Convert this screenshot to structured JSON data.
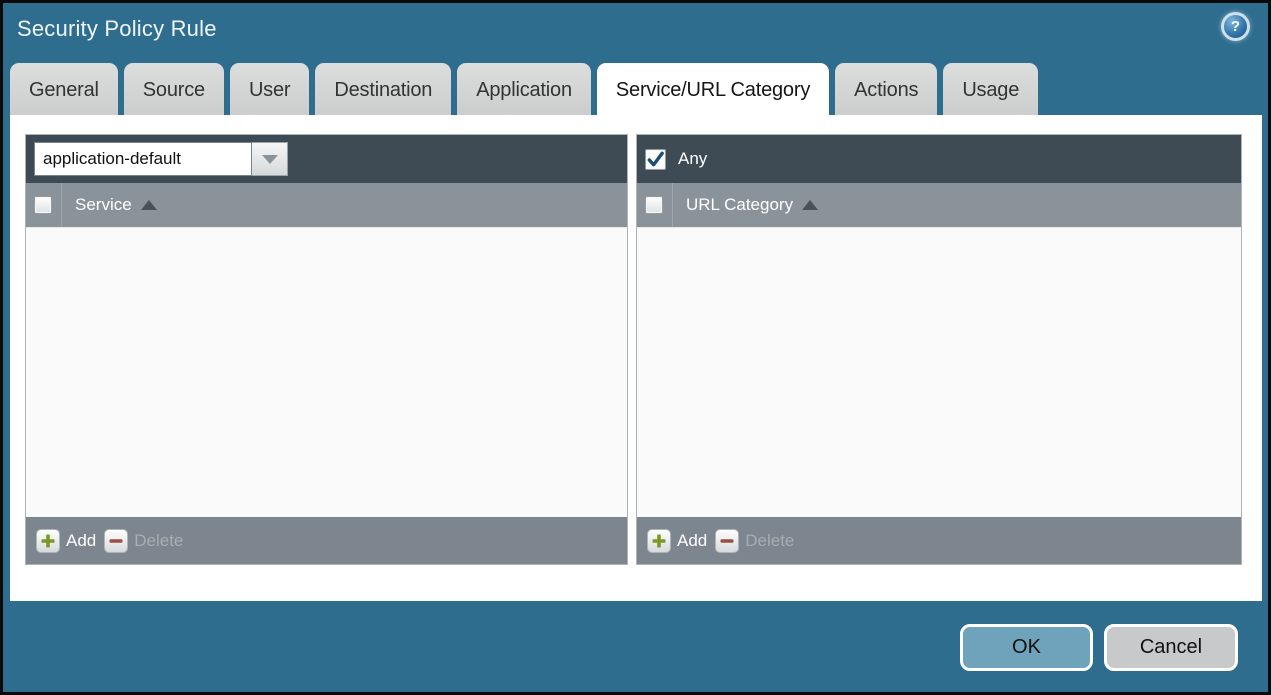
{
  "window": {
    "title": "Security Policy Rule"
  },
  "tabs": [
    {
      "label": "General",
      "active": false
    },
    {
      "label": "Source",
      "active": false
    },
    {
      "label": "User",
      "active": false
    },
    {
      "label": "Destination",
      "active": false
    },
    {
      "label": "Application",
      "active": false
    },
    {
      "label": "Service/URL Category",
      "active": true
    },
    {
      "label": "Actions",
      "active": false
    },
    {
      "label": "Usage",
      "active": false
    }
  ],
  "service_panel": {
    "dropdown_value": "application-default",
    "select_all_checked": false,
    "column_header": "Service",
    "sort_order": "ascending",
    "rows": [],
    "add_label": "Add",
    "delete_label": "Delete",
    "delete_enabled": false
  },
  "url_category_panel": {
    "any_label": "Any",
    "any_checked": true,
    "select_all_checked": false,
    "column_header": "URL Category",
    "sort_order": "ascending",
    "rows": [],
    "add_label": "Add",
    "delete_label": "Delete",
    "delete_enabled": false
  },
  "footer": {
    "ok_label": "OK",
    "cancel_label": "Cancel"
  },
  "icons": {
    "help": "help-icon",
    "add": "plus-icon",
    "delete": "minus-icon",
    "dropdown": "chevron-down-icon",
    "sort": "sort-ascending-icon"
  },
  "colors": {
    "dialog_background": "#2f6d8e",
    "panel_header": "#3f4b54",
    "column_header": "#8a939a",
    "action_bar": "#7d868e",
    "tab_inactive": "#d4d4d4",
    "tab_active": "#ffffff",
    "ok_button": "#6fa2bb",
    "cancel_button": "#c8c9ca",
    "add_plus": "#7d9722",
    "delete_minus": "#9a4f45",
    "check_mark": "#1d4e74"
  }
}
